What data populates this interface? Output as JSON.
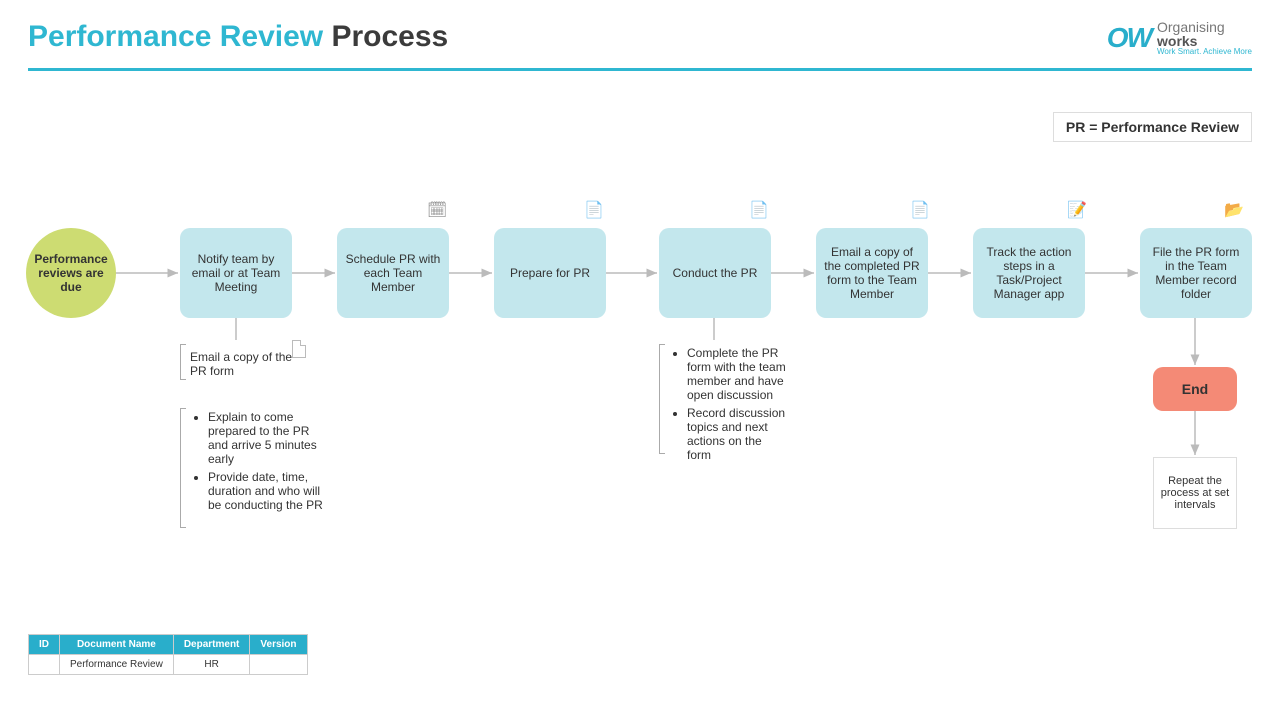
{
  "title": {
    "accent": "Performance Review",
    "rest": " Process"
  },
  "brand": {
    "mark": "OW",
    "top": "Organising",
    "bot": "works",
    "tag": "Work Smart. Achieve More"
  },
  "legend": "PR = Performance Review",
  "nodes": {
    "start": "Performance reviews are due",
    "step1": "Notify team by email or at Team Meeting",
    "step2": "Schedule PR with each Team Member",
    "step3": "Prepare for PR",
    "step4": "Conduct the PR",
    "step5": "Email a copy of the completed PR form to the Team Member",
    "step6": "Track the action steps in a Task/Project Manager app",
    "step7": "File the PR form in the Team Member record folder",
    "end": "End",
    "repeat": "Repeat the process at set intervals"
  },
  "notes": {
    "notify_email": "Email a copy of the PR form",
    "notify_bullets": [
      "Explain to come prepared to the PR and arrive 5 minutes early",
      "Provide date, time, duration and who will be conducting the PR"
    ],
    "conduct_bullets": [
      "Complete the PR form with the team member and have open discussion",
      "Record discussion topics and next actions on the form"
    ]
  },
  "table": {
    "headers": [
      "ID",
      "Document Name",
      "Department",
      "Version"
    ],
    "row": [
      "",
      "Performance Review",
      "HR",
      ""
    ]
  },
  "chart_data": {
    "type": "flowchart",
    "title": "Performance Review Process",
    "legend": "PR = Performance Review",
    "nodes": [
      {
        "id": "start",
        "type": "start",
        "label": "Performance reviews are due"
      },
      {
        "id": "n1",
        "type": "process",
        "label": "Notify team by email or at Team Meeting",
        "icon": null,
        "notes": [
          "Email a copy of the PR form",
          "Explain to come prepared to the PR and arrive 5 minutes early",
          "Provide date, time, duration and who will be conducting the PR"
        ]
      },
      {
        "id": "n2",
        "type": "process",
        "label": "Schedule PR with each Team Member",
        "icon": "calendar"
      },
      {
        "id": "n3",
        "type": "process",
        "label": "Prepare for PR",
        "icon": "document"
      },
      {
        "id": "n4",
        "type": "process",
        "label": "Conduct the PR",
        "icon": "document",
        "notes": [
          "Complete the PR form with the team member and have open discussion",
          "Record discussion topics and next actions on the form"
        ]
      },
      {
        "id": "n5",
        "type": "process",
        "label": "Email a copy of the completed PR form to the Team Member",
        "icon": "document"
      },
      {
        "id": "n6",
        "type": "process",
        "label": "Track the action steps in a Task/Project Manager app",
        "icon": "notepad"
      },
      {
        "id": "n7",
        "type": "process",
        "label": "File the PR form in the Team Member record folder",
        "icon": "folder"
      },
      {
        "id": "end",
        "type": "end",
        "label": "End"
      },
      {
        "id": "repeat",
        "type": "note",
        "label": "Repeat the process at set intervals"
      }
    ],
    "edges": [
      [
        "start",
        "n1"
      ],
      [
        "n1",
        "n2"
      ],
      [
        "n2",
        "n3"
      ],
      [
        "n3",
        "n4"
      ],
      [
        "n4",
        "n5"
      ],
      [
        "n5",
        "n6"
      ],
      [
        "n6",
        "n7"
      ],
      [
        "n7",
        "end"
      ],
      [
        "end",
        "repeat"
      ]
    ],
    "metadata_table": {
      "headers": [
        "ID",
        "Document Name",
        "Department",
        "Version"
      ],
      "rows": [
        [
          "",
          "Performance Review",
          "HR",
          ""
        ]
      ]
    }
  }
}
